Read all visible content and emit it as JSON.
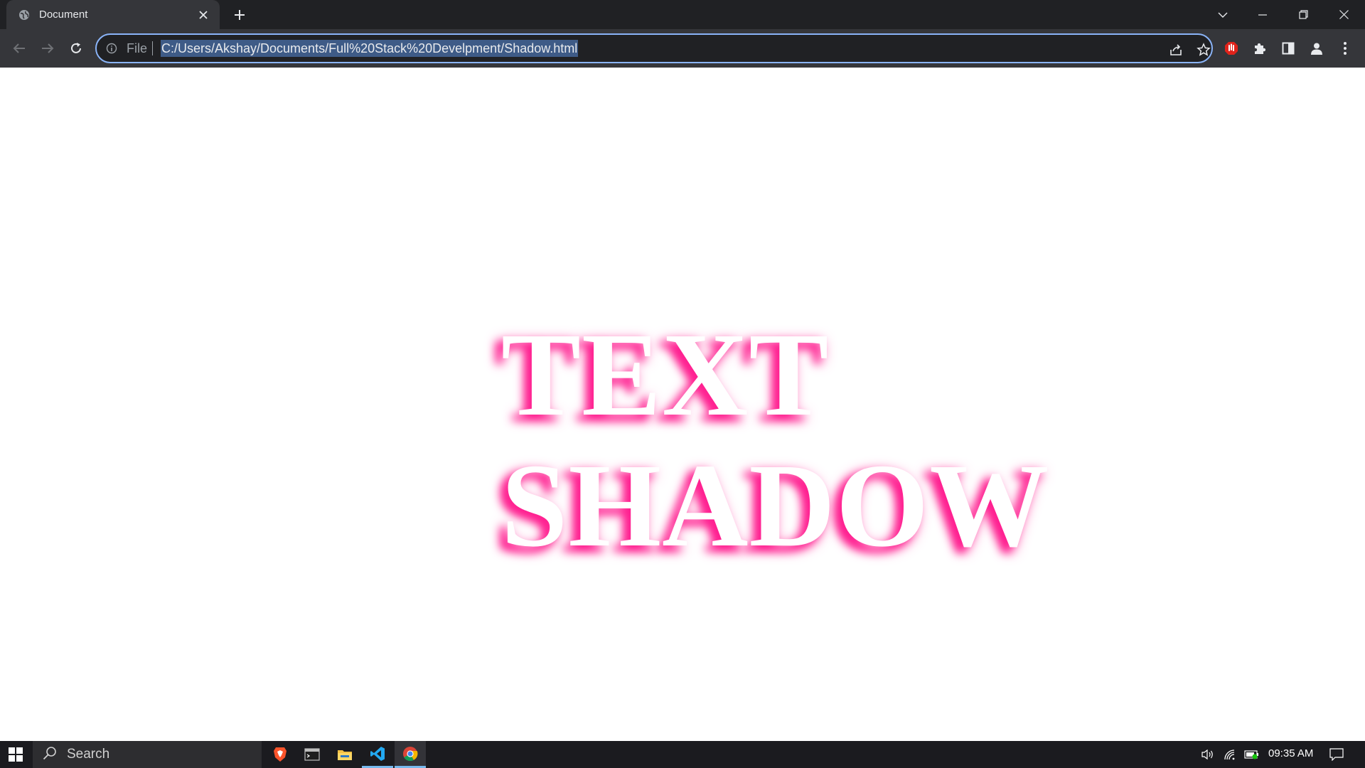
{
  "browser": {
    "tab": {
      "title": "Document",
      "favicon": "globe-icon"
    },
    "address_bar": {
      "scheme_label": "File",
      "url": "C:/Users/Akshay/Documents/Full%20Stack%20Develpment/Shadow.html"
    },
    "accent_color": "#8ab4f8",
    "chrome_color": "#35363a",
    "icons": [
      "back-icon",
      "forward-icon",
      "reload-icon",
      "info-icon",
      "share-icon",
      "star-icon",
      "adblock-extension-icon",
      "extensions-puzzle-icon",
      "side-panel-icon",
      "profile-icon",
      "menu-kebab-icon",
      "tab-search-icon",
      "minimize-icon",
      "restore-icon",
      "close-icon"
    ]
  },
  "page": {
    "lines": [
      "TEXT",
      "SHADOW"
    ],
    "text_color": "#ffffff",
    "shadow_color": "#ff1f90"
  },
  "taskbar": {
    "search_placeholder": "Search",
    "apps": [
      "brave-browser-icon",
      "terminal-icon",
      "file-explorer-icon",
      "vscode-icon",
      "chrome-icon"
    ],
    "clock": "09:35 AM"
  }
}
